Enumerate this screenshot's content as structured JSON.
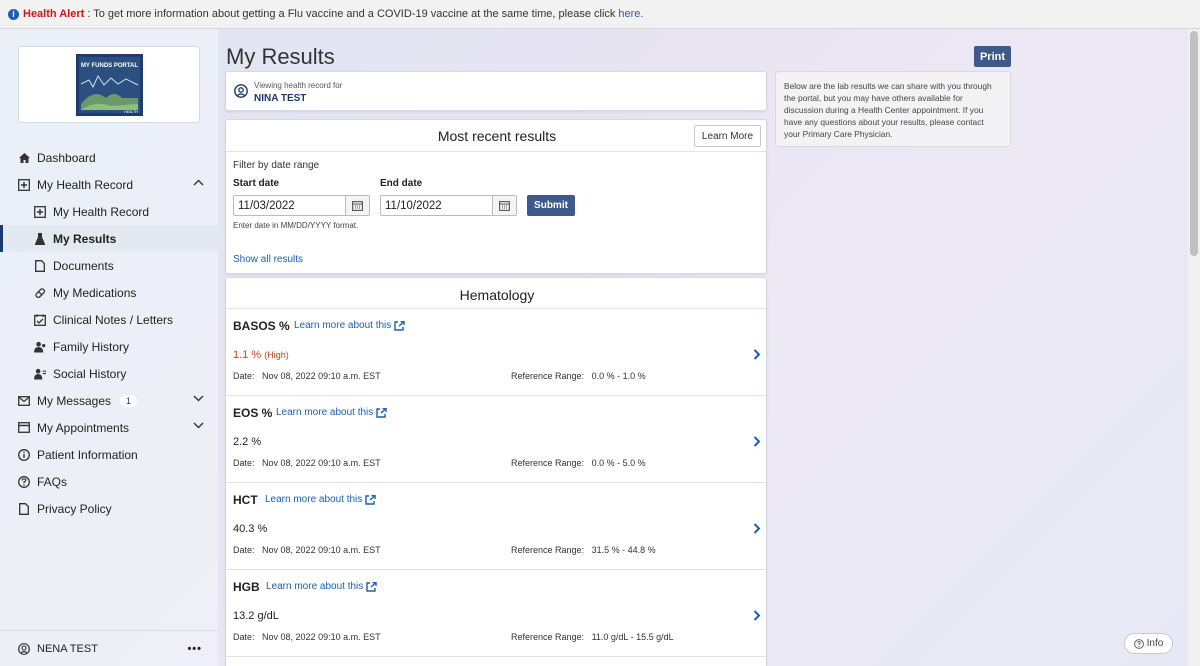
{
  "alert": {
    "label": "Health Alert",
    "message": ": To get more information about getting a Flu vaccine and a COVID-19 vaccine at the same time, please click",
    "link": "here."
  },
  "logo": {
    "title": "MY FUNDS PORTAL",
    "sub": "HEALTH"
  },
  "sidebar": {
    "items": [
      {
        "label": "Dashboard",
        "icon": "home-icon"
      },
      {
        "label": "My Health Record",
        "icon": "record-icon"
      },
      {
        "label": "My Health Record",
        "icon": "record-icon"
      },
      {
        "label": "My Results",
        "icon": "flask-icon"
      },
      {
        "label": "Documents",
        "icon": "document-icon"
      },
      {
        "label": "My Medications",
        "icon": "pill-icon"
      },
      {
        "label": "Clinical Notes / Letters",
        "icon": "notes-icon"
      },
      {
        "label": "Family History",
        "icon": "family-icon"
      },
      {
        "label": "Social History",
        "icon": "social-icon"
      },
      {
        "label": "My Messages",
        "icon": "envelope-icon",
        "badge": "1"
      },
      {
        "label": "My Appointments",
        "icon": "calendar-icon"
      },
      {
        "label": "Patient Information",
        "icon": "info-icon"
      },
      {
        "label": "FAQs",
        "icon": "question-icon"
      },
      {
        "label": "Privacy Policy",
        "icon": "document-icon"
      }
    ],
    "user": "NENA TEST"
  },
  "main": {
    "title": "My Results",
    "print": "Print",
    "viewing_label": "Viewing health record for",
    "patient_name": "NINA TEST",
    "info_text": "Below are the lab results we can share with you through the portal, but you may have others available for discussion during a Health Center appointment.  If you have any questions about your results, please contact your Primary Care Physician.",
    "recent": {
      "title": "Most recent results",
      "learn_more": "Learn More",
      "filter_label": "Filter by date range",
      "start_label": "Start date",
      "end_label": "End date",
      "start_value": "11/03/2022",
      "end_value": "11/10/2022",
      "submit": "Submit",
      "hint": "Enter date in MM/DD/YYYY format.",
      "show_all": "Show all results"
    },
    "hematology": {
      "title": "Hematology",
      "learn_link": "Learn more about this",
      "date_label": "Date:",
      "ref_label": "Reference Range:",
      "results": [
        {
          "name": "BASOS %",
          "value": "1.1 %",
          "flag": "(High)",
          "date": "Nov 08, 2022 09:10 a.m. EST",
          "range": "0.0 % - 1.0 %"
        },
        {
          "name": "EOS %",
          "value": "2.2 %",
          "flag": "",
          "date": "Nov 08, 2022 09:10 a.m. EST",
          "range": "0.0 % - 5.0 %"
        },
        {
          "name": "HCT",
          "value": "40.3 %",
          "flag": "",
          "date": "Nov 08, 2022 09:10 a.m. EST",
          "range": "31.5 % - 44.8 %"
        },
        {
          "name": "HGB",
          "value": "13.2 g/dL",
          "flag": "",
          "date": "Nov 08, 2022 09:10 a.m. EST",
          "range": "11.0 g/dL - 15.5 g/dL"
        }
      ]
    },
    "info_button": "Info"
  }
}
